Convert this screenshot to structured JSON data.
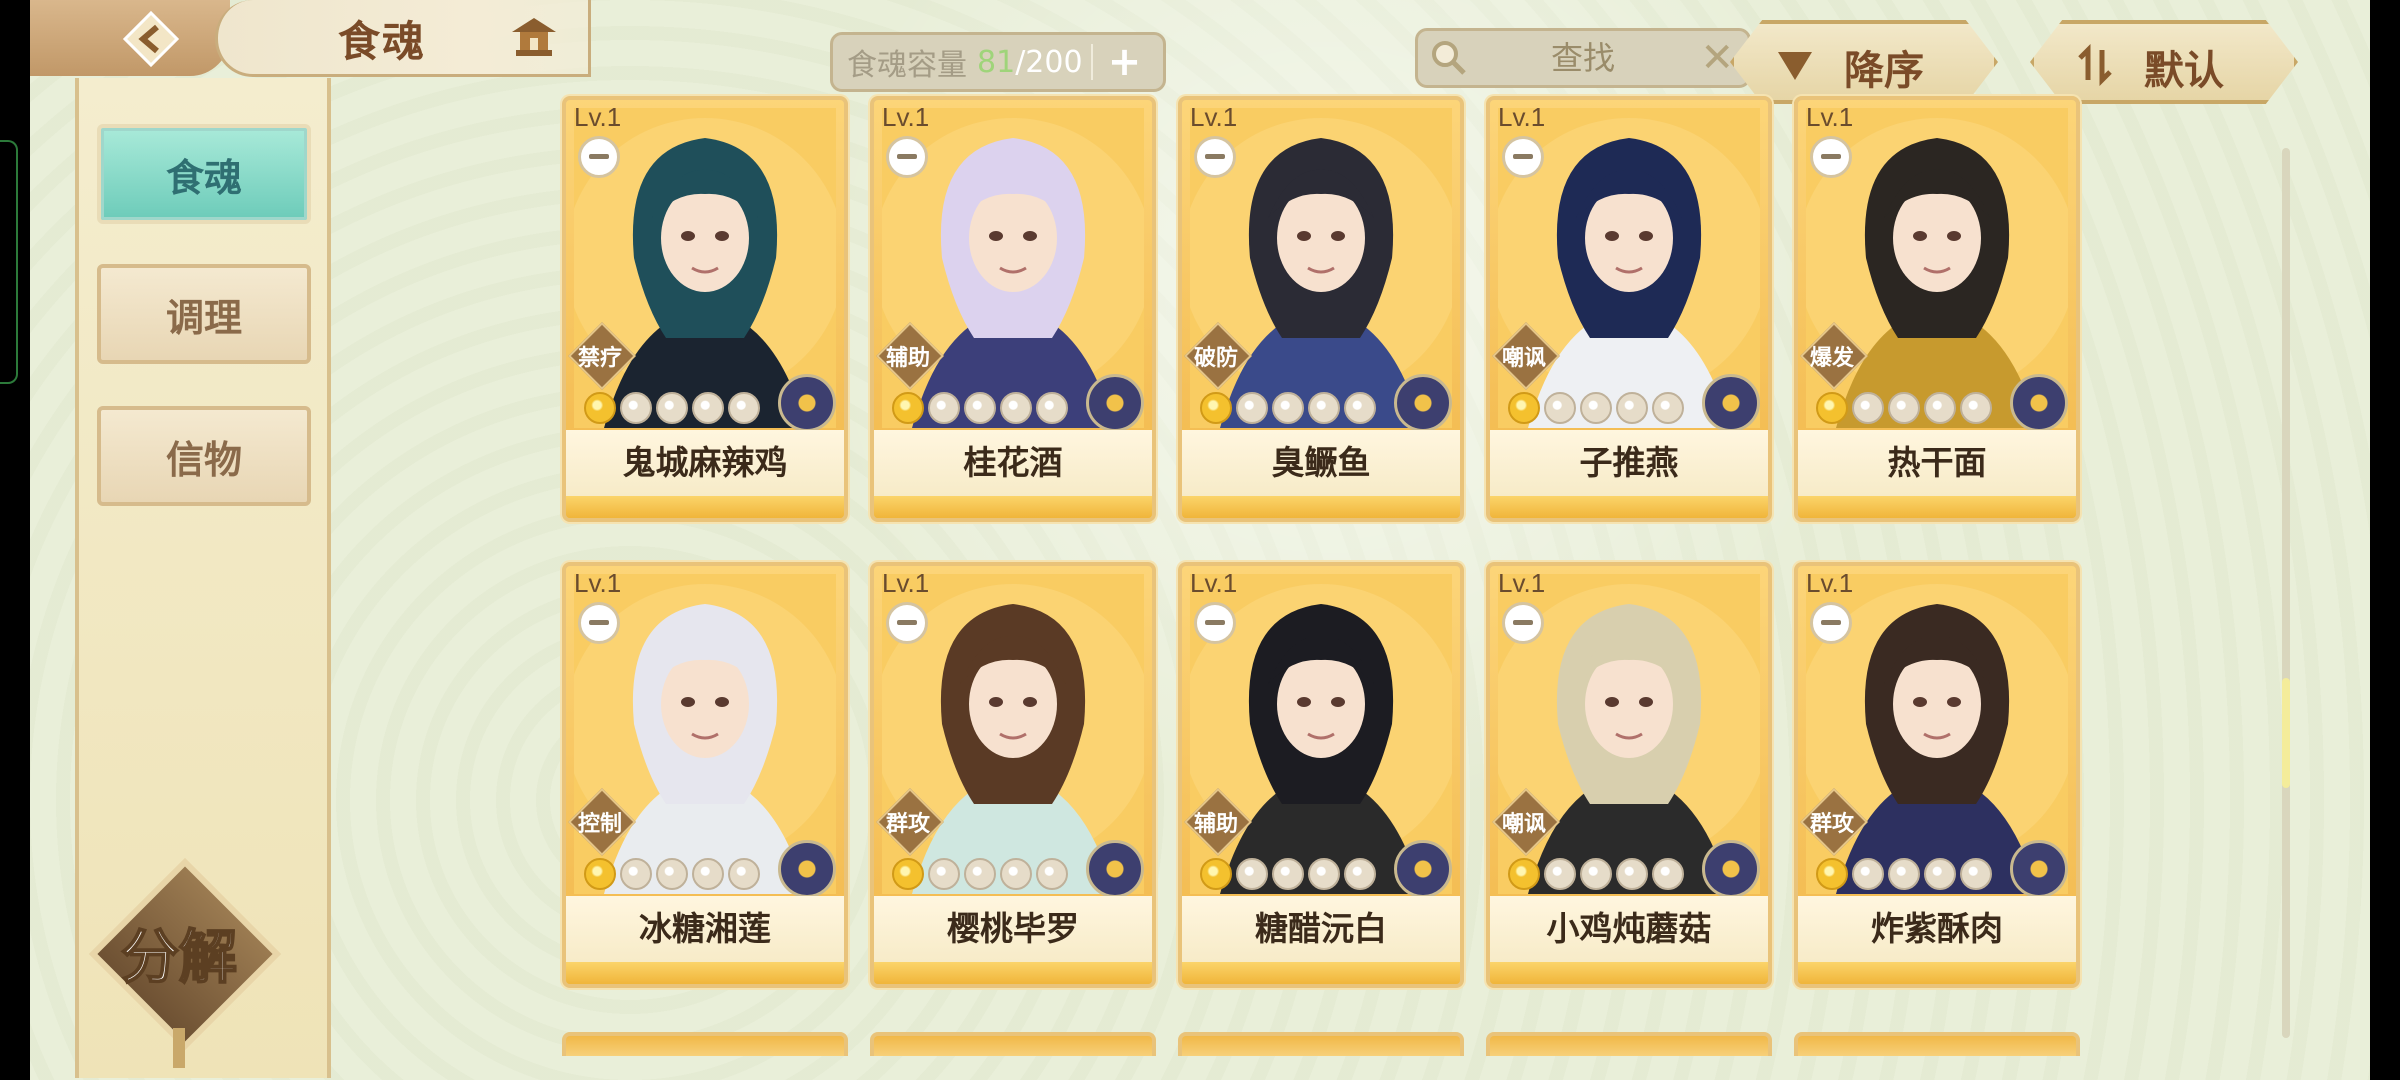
{
  "header": {
    "title": "食魂",
    "capacity_label": "食魂容量",
    "capacity_current": "81",
    "capacity_separator": "/",
    "capacity_max": "200",
    "plus_label": "+",
    "search_placeholder": "查找",
    "sort_order_label": "降序",
    "sort_mode_label": "默认"
  },
  "sidebar": {
    "items": [
      {
        "label": "食魂",
        "active": true
      },
      {
        "label": "调理",
        "active": false
      },
      {
        "label": "信物",
        "active": false
      }
    ],
    "decompose_label": "分解"
  },
  "cards": [
    {
      "level": "Lv.1",
      "name": "鬼城麻辣鸡",
      "role": "禁疗",
      "stars_on": 1,
      "stars_total": 5
    },
    {
      "level": "Lv.1",
      "name": "桂花酒",
      "role": "辅助",
      "stars_on": 1,
      "stars_total": 5
    },
    {
      "level": "Lv.1",
      "name": "臭鳜鱼",
      "role": "破防",
      "stars_on": 1,
      "stars_total": 5
    },
    {
      "level": "Lv.1",
      "name": "子推燕",
      "role": "嘲讽",
      "stars_on": 1,
      "stars_total": 5
    },
    {
      "level": "Lv.1",
      "name": "热干面",
      "role": "爆发",
      "stars_on": 1,
      "stars_total": 5
    },
    {
      "level": "Lv.1",
      "name": "冰糖湘莲",
      "role": "控制",
      "stars_on": 1,
      "stars_total": 5
    },
    {
      "level": "Lv.1",
      "name": "樱桃毕罗",
      "role": "群攻",
      "stars_on": 1,
      "stars_total": 5
    },
    {
      "level": "Lv.1",
      "name": "糖醋沅白",
      "role": "辅助",
      "stars_on": 1,
      "stars_total": 5
    },
    {
      "level": "Lv.1",
      "name": "小鸡炖蘑菇",
      "role": "嘲讽",
      "stars_on": 1,
      "stars_total": 5
    },
    {
      "level": "Lv.1",
      "name": "炸紫酥肉",
      "role": "群攻",
      "stars_on": 1,
      "stars_total": 5
    }
  ],
  "colors": {
    "hair": [
      "#1f4f5a",
      "#dcd2ee",
      "#2b2b35",
      "#1e2a55",
      "#2b2622",
      "#e6e6ee",
      "#5a3a25",
      "#1c1c22",
      "#d8cfae",
      "#3a2a22"
    ],
    "outfit": [
      "#1b2430",
      "#3c3f7a",
      "#3a4a8a",
      "#eef0f3",
      "#c79a2e",
      "#e9ecef",
      "#cfe7e0",
      "#2a2a2a",
      "#2b2b2b",
      "#2d3060"
    ]
  },
  "icons": {
    "back": "back-arrow-icon",
    "home": "pavilion-icon",
    "search": "magnifier-icon",
    "clear": "close-icon",
    "sort_desc": "triangle-down-icon",
    "sort_default": "swap-icon"
  },
  "scroll_position": 0.6
}
